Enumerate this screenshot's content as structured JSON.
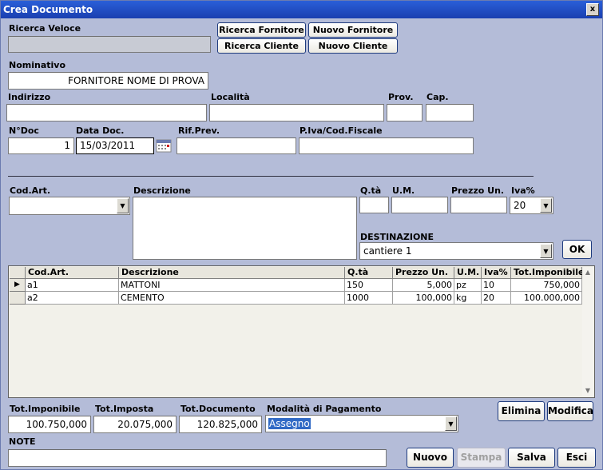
{
  "window": {
    "title": "Crea Documento",
    "close_glyph": "x"
  },
  "quick_search": {
    "label": "Ricerca Veloce",
    "value": ""
  },
  "buttons": {
    "search_supplier": "Ricerca Fornitore",
    "new_supplier": "Nuovo Fornitore",
    "search_client": "Ricerca Cliente",
    "new_client": "Nuovo Cliente",
    "ok": "OK",
    "delete": "Elimina",
    "modify": "Modifica",
    "new": "Nuovo",
    "print": "Stampa",
    "save": "Salva",
    "exit": "Esci"
  },
  "header": {
    "nominativo_label": "Nominativo",
    "nominativo_value": "FORNITORE NOME DI PROVA",
    "indirizzo_label": "Indirizzo",
    "indirizzo_value": "",
    "localita_label": "Località",
    "localita_value": "",
    "prov_label": "Prov.",
    "prov_value": "",
    "cap_label": "Cap.",
    "cap_value": "",
    "ndoc_label": "N°Doc",
    "ndoc_value": "1",
    "datadoc_label": "Data Doc.",
    "datadoc_value": "15/03/2011",
    "rifprev_label": "Rif.Prev.",
    "rifprev_value": "",
    "piva_label": "P.Iva/Cod.Fiscale",
    "piva_value": ""
  },
  "item_entry": {
    "codart_label": "Cod.Art.",
    "codart_value": "",
    "descr_label": "Descrizione",
    "descr_value": "",
    "qta_label": "Q.tà",
    "qta_value": "",
    "um_label": "U.M.",
    "um_value": "",
    "prezzo_label": "Prezzo Un.",
    "prezzo_value": "",
    "iva_label": "Iva%",
    "iva_value": "20",
    "dest_label": "DESTINAZIONE",
    "dest_value": "cantiere 1"
  },
  "grid": {
    "columns": [
      "Cod.Art.",
      "Descrizione",
      "Q.tà",
      "Prezzo Un.",
      "U.M.",
      "Iva%",
      "Tot.Imponibile"
    ],
    "rows": [
      [
        "a1",
        "MATTONI",
        "150",
        "5,000",
        "pz",
        "10",
        "750,000"
      ],
      [
        "a2",
        "CEMENTO",
        "1000",
        "100,000",
        "kg",
        "20",
        "100.000,000"
      ]
    ],
    "row_pointer": "▶"
  },
  "totals": {
    "imponibile_label": "Tot.Imponibile",
    "imponibile_value": "100.750,000",
    "imposta_label": "Tot.Imposta",
    "imposta_value": "20.075,000",
    "documento_label": "Tot.Documento",
    "documento_value": "120.825,000",
    "pagamento_label": "Modalità di Pagamento",
    "pagamento_value": "Assegno"
  },
  "note": {
    "label": "NOTE",
    "value": ""
  }
}
